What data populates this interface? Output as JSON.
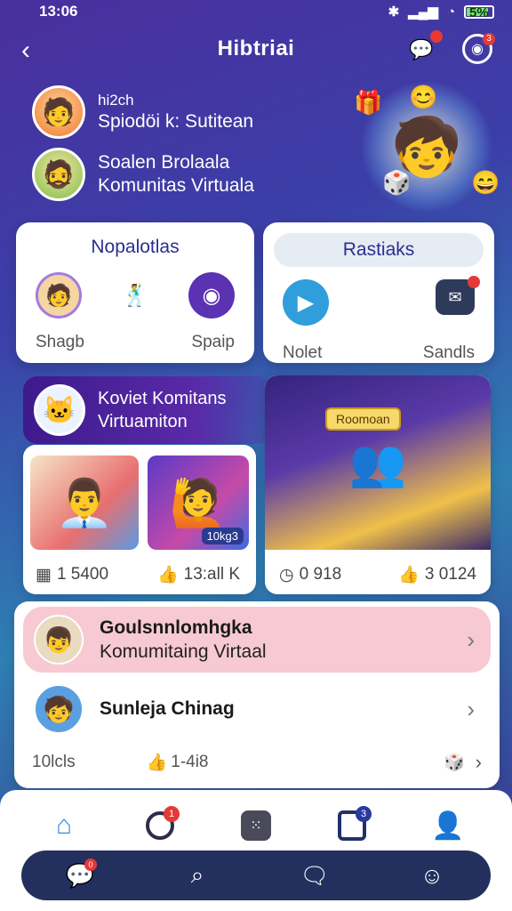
{
  "status": {
    "time": "13:06",
    "battery_label": "5%",
    "battery_level": 0.85
  },
  "header": {
    "title": "Hibtriai",
    "chat_badge": "",
    "target_badge": "3"
  },
  "profile": {
    "row1_small": "hi2ch",
    "row1_big": "Spiodöi k: Sutitean",
    "row2_line1": "Soalen Brolaala",
    "row2_line2": "Komunitas Virtuala"
  },
  "card_left": {
    "title": "Nopalotlas",
    "labels": [
      "Shagb",
      "Spaip"
    ]
  },
  "card_right": {
    "title": "Rastiaks",
    "labels": [
      "Nolet",
      "Sandls"
    ]
  },
  "banner": {
    "line1": "Koviet Komitans",
    "line2": "Virtuamiton"
  },
  "media_left": {
    "thumb_tag": "10kg3",
    "stat1": "1 5400",
    "stat2": "13:all K"
  },
  "media_right": {
    "room_sign": "Roomoan",
    "stat1": "0 918",
    "stat2": "3 0124"
  },
  "list": {
    "item1": {
      "name": "Goulsnnlomhgka",
      "sub": "Komumitaing Virtaal"
    },
    "item2": {
      "name": "Sunleja Chinag"
    },
    "footer_left": "10lcls",
    "footer_mid": "1-4i8"
  },
  "nav": {
    "ring_badge": "1",
    "box_badge": "3"
  },
  "dock": {
    "chat_badge": "0"
  }
}
